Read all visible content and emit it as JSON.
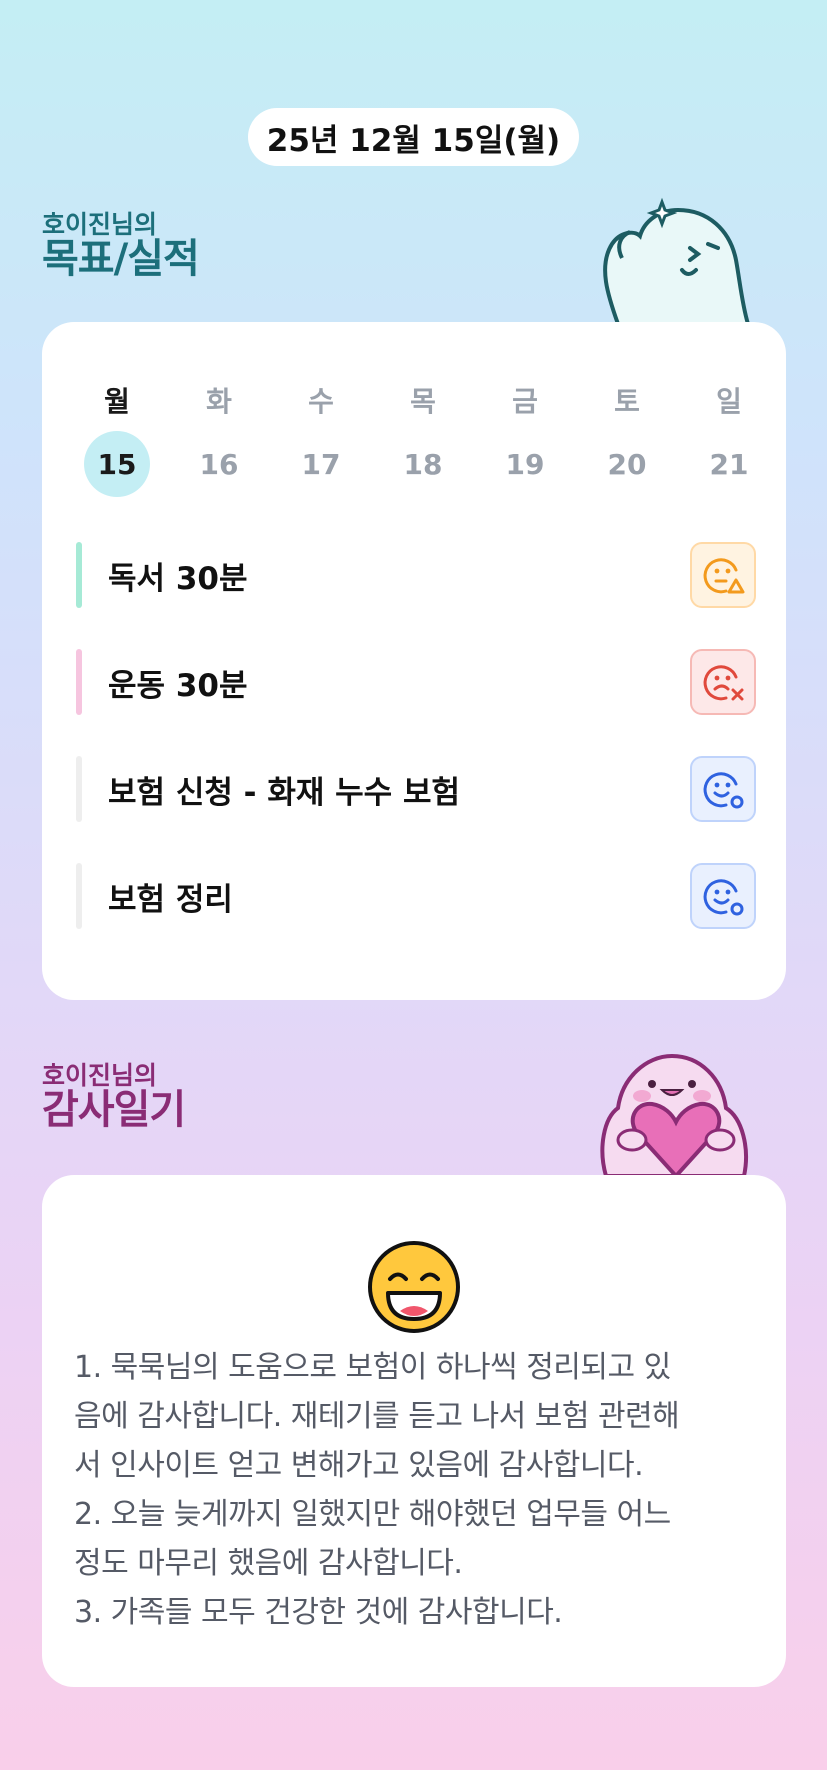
{
  "header": {
    "date": "25년 12월 15일(월)"
  },
  "goals_section": {
    "subtitle": "호이진님의",
    "title": "목표/실적",
    "mascot_icon": "waving-ghost-mascot"
  },
  "week": {
    "days": [
      "월",
      "화",
      "수",
      "목",
      "금",
      "토",
      "일"
    ],
    "dates": [
      "15",
      "16",
      "17",
      "18",
      "19",
      "20",
      "21"
    ],
    "selected_index": 0
  },
  "goals": [
    {
      "label": "독서 30분",
      "bar_color": "#a6ead6",
      "status_icon": "face-warning-icon",
      "status_color": "#f39a1d"
    },
    {
      "label": "운동 30분",
      "bar_color": "#f6c5df",
      "status_icon": "face-fail-icon",
      "status_color": "#e0493c"
    },
    {
      "label": "보험 신청 - 화재 누수 보험",
      "bar_color": "#eeeeee",
      "status_icon": "face-pending-icon",
      "status_color": "#2f62e0"
    },
    {
      "label": "보험 정리",
      "bar_color": "#eeeeee",
      "status_icon": "face-pending-icon",
      "status_color": "#2f62e0"
    }
  ],
  "diary_section": {
    "subtitle": "호이진님의",
    "title": "감사일기",
    "mascot_icon": "heart-ghost-mascot"
  },
  "diary": {
    "mood_icon": "grinning-face-emoji",
    "text": "1. 묵묵님의 도움으로 보험이 하나씩 정리되고 있\n음에 감사합니다. 재테기를 듣고 나서 보험 관련해\n서 인사이트 얻고 변해가고 있음에 감사합니다.\n2. 오늘 늦게까지 일했지만 해야했던 업무들 어느\n정도 마무리 했음에 감사합니다.\n3. 가족들 모두 건강한 것에 감사합니다."
  }
}
